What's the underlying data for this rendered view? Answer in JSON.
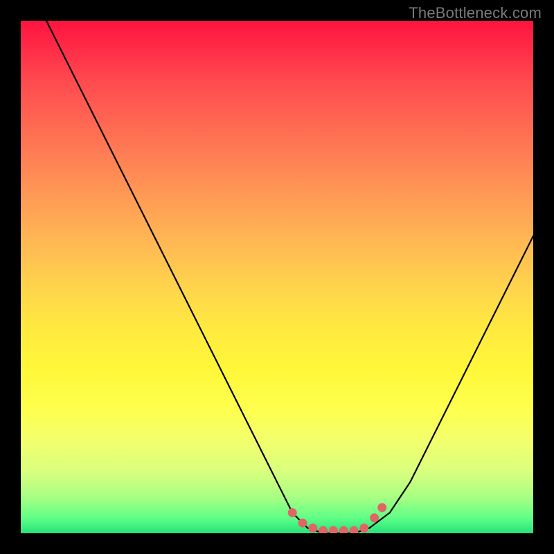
{
  "attribution": "TheBottleneck.com",
  "colors": {
    "frame": "#000000",
    "curve": "#000000",
    "marker": "#e06666",
    "gradient_stops": [
      {
        "pos": 0.0,
        "hex": "#ff143f"
      },
      {
        "pos": 0.04,
        "hex": "#ff2545"
      },
      {
        "pos": 0.12,
        "hex": "#ff4b4f"
      },
      {
        "pos": 0.22,
        "hex": "#ff6f53"
      },
      {
        "pos": 0.32,
        "hex": "#ff9255"
      },
      {
        "pos": 0.42,
        "hex": "#ffb454"
      },
      {
        "pos": 0.52,
        "hex": "#ffd44c"
      },
      {
        "pos": 0.6,
        "hex": "#ffe93f"
      },
      {
        "pos": 0.68,
        "hex": "#fff739"
      },
      {
        "pos": 0.76,
        "hex": "#feff4f"
      },
      {
        "pos": 0.82,
        "hex": "#f2ff6c"
      },
      {
        "pos": 0.88,
        "hex": "#d9ff7e"
      },
      {
        "pos": 0.93,
        "hex": "#a7ff83"
      },
      {
        "pos": 0.97,
        "hex": "#60ff87"
      },
      {
        "pos": 1.0,
        "hex": "#25e27a"
      }
    ]
  },
  "chart_data": {
    "type": "line",
    "title": "",
    "xlabel": "",
    "ylabel": "",
    "xlim": [
      0,
      100
    ],
    "ylim": [
      0,
      100
    ],
    "series": [
      {
        "name": "curve",
        "x": [
          5,
          10,
          15,
          20,
          25,
          30,
          35,
          40,
          45,
          50,
          53,
          56,
          59,
          62,
          65,
          68,
          72,
          76,
          80,
          84,
          88,
          92,
          96,
          100
        ],
        "y": [
          100,
          90,
          80,
          70,
          60,
          50,
          40,
          30,
          20,
          10,
          4,
          1,
          0,
          0,
          0,
          1,
          4,
          10,
          18,
          26,
          34,
          42,
          50,
          58
        ]
      }
    ],
    "markers": {
      "name": "highlight-dots",
      "x": [
        53,
        55,
        57,
        59,
        61,
        63,
        65,
        67,
        69,
        70.5
      ],
      "y": [
        4,
        2,
        1,
        0.5,
        0.5,
        0.5,
        0.5,
        1,
        3,
        5
      ]
    }
  }
}
